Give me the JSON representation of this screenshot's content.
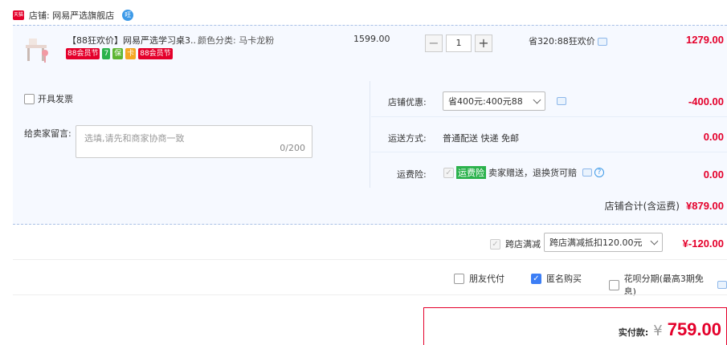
{
  "shop": {
    "logo_text": "天猫",
    "label": "店铺: 网易严选旗舰店",
    "ww_text": "旺"
  },
  "product": {
    "title": "【88狂欢价】网易严选学习桌3...",
    "option_label": "颜色分类: 马卡龙粉",
    "badges": [
      {
        "text": "88会员节",
        "color": "#e4002b"
      },
      {
        "text": "7",
        "color": "#2bb24c"
      },
      {
        "text": "保",
        "color": "#5cb531"
      },
      {
        "text": "卡",
        "color": "#f5a623"
      },
      {
        "text": "88会员节",
        "color": "#e4002b"
      }
    ],
    "unit_price": "1599.00",
    "quantity": "1",
    "minus": "−",
    "plus": "+",
    "discount_note": "省320:88狂欢价",
    "subtotal": "1279.00"
  },
  "invoice": {
    "label": "开具发票"
  },
  "message": {
    "label": "给卖家留言:",
    "placeholder": "选填,请先和商家协商一致",
    "counter": "0/200"
  },
  "shop_coupon": {
    "label": "店铺优惠:",
    "selected": "省400元:400元88",
    "amount": "-400.00"
  },
  "shipping": {
    "label": "运送方式:",
    "value": "普通配送 快递 免邮",
    "amount": "0.00"
  },
  "insurance": {
    "label": "运费险:",
    "tag": "运费险",
    "desc": "卖家赠送，退换货可赔",
    "amount": "0.00"
  },
  "shop_total": {
    "label": "店铺合计(含运费)",
    "amount": "¥879.00"
  },
  "cross_store": {
    "label": "跨店满减",
    "selected": "跨店满减抵扣120.00元",
    "amount": "¥-120.00"
  },
  "pay_options": [
    {
      "label": "朋友代付",
      "checked": false
    },
    {
      "label": "匿名购买",
      "checked": true
    },
    {
      "label": "花呗分期(最高3期免息)",
      "checked": false
    }
  ],
  "payment": {
    "label": "实付款:",
    "currency": "¥",
    "amount": "759.00"
  },
  "colors": {
    "accent_red": "#e4002b",
    "accent_blue": "#3c7ef5",
    "panel_bg": "#f6f9ff"
  }
}
